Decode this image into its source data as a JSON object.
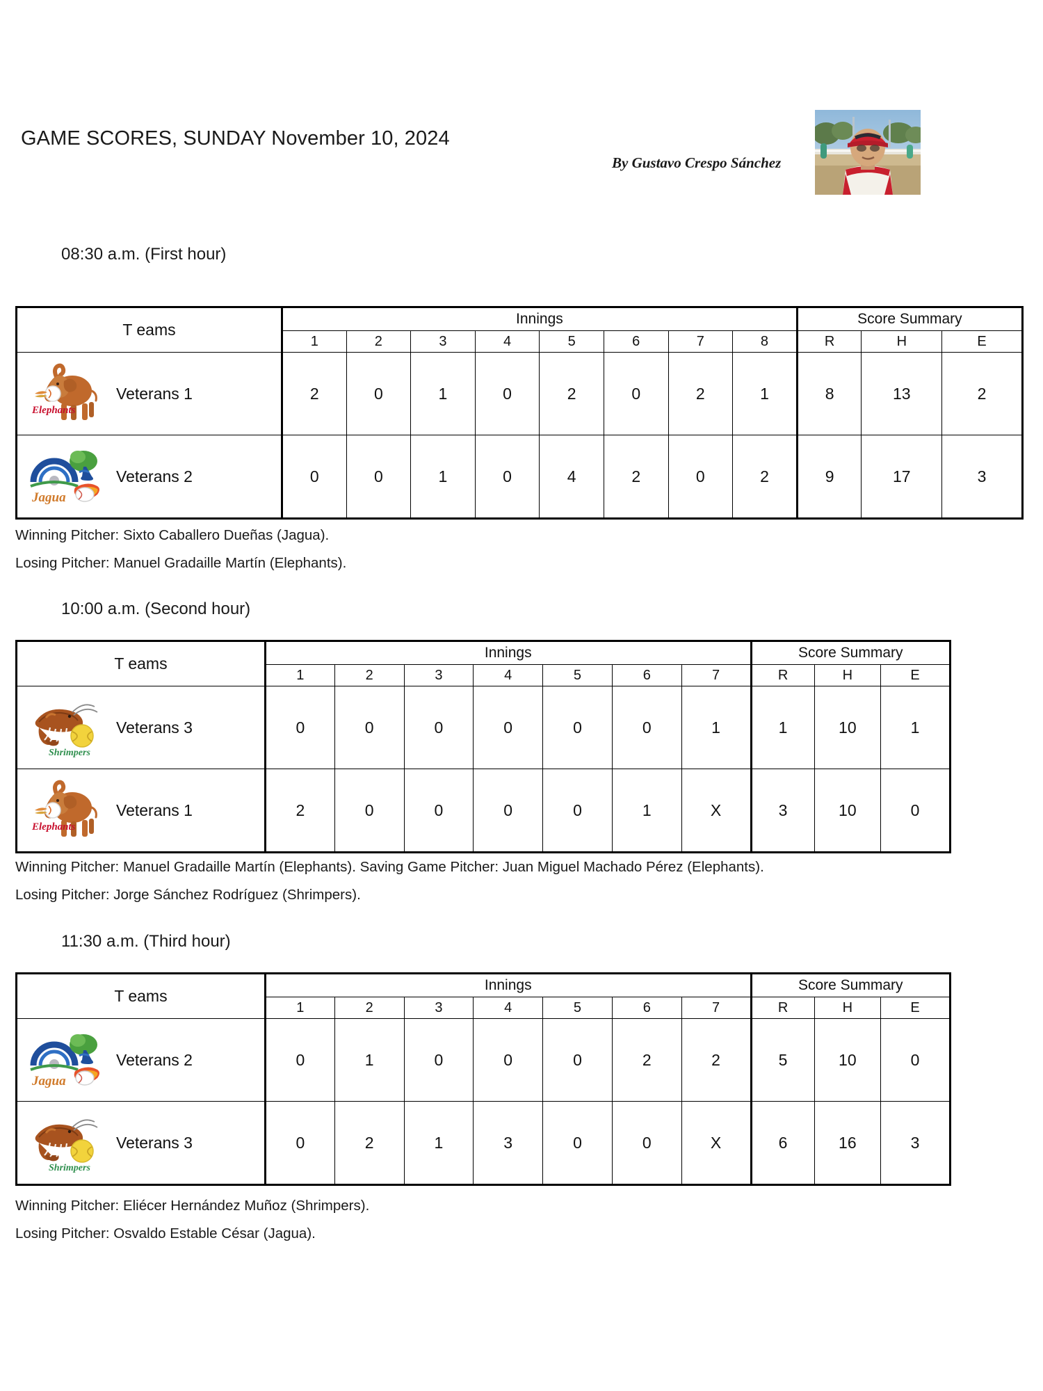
{
  "header": {
    "title": "GAME SCORES, SUNDAY November 10, 2024",
    "byline": "By Gustavo Crespo Sánchez",
    "photo_alt": "author-portrait"
  },
  "labels": {
    "teams": "T eams",
    "innings": "Innings",
    "score_summary": "Score Summary",
    "runs": "R",
    "hits": "H",
    "errors": "E"
  },
  "games": [
    {
      "time_heading": "08:30 a.m. (First hour)",
      "innings_headers": [
        "1",
        "2",
        "3",
        "4",
        "5",
        "6",
        "7",
        "8"
      ],
      "rows": [
        {
          "logo": "elephants-logo",
          "team": "Veterans 1",
          "innings": [
            "2",
            "0",
            "1",
            "0",
            "2",
            "0",
            "2",
            "1"
          ],
          "r": "8",
          "h": "13",
          "e": "2"
        },
        {
          "logo": "jagua-logo",
          "team": "Veterans 2",
          "innings": [
            "0",
            "0",
            "1",
            "0",
            "4",
            "2",
            "0",
            "2"
          ],
          "r": "9",
          "h": "17",
          "e": "3"
        }
      ],
      "notes": [
        "Winning Pitcher: Sixto Caballero Dueñas (Jagua).",
        "Losing Pitcher: Manuel Gradaille Martín (Elephants)."
      ]
    },
    {
      "time_heading": "10:00 a.m. (Second hour)",
      "innings_headers": [
        "1",
        "2",
        "3",
        "4",
        "5",
        "6",
        "7"
      ],
      "rows": [
        {
          "logo": "shrimpers-logo",
          "team": "Veterans 3",
          "innings": [
            "0",
            "0",
            "0",
            "0",
            "0",
            "0",
            "1"
          ],
          "r": "1",
          "h": "10",
          "e": "1"
        },
        {
          "logo": "elephants-logo",
          "team": "Veterans 1",
          "innings": [
            "2",
            "0",
            "0",
            "0",
            "0",
            "1",
            "X"
          ],
          "r": "3",
          "h": "10",
          "e": "0"
        }
      ],
      "notes": [
        "Winning Pitcher: Manuel Gradaille Martín (Elephants). Saving Game Pitcher: Juan Miguel Machado Pérez (Elephants).",
        "Losing Pitcher: Jorge Sánchez Rodríguez (Shrimpers)."
      ]
    },
    {
      "time_heading": "11:30 a.m. (Third hour)",
      "innings_headers": [
        "1",
        "2",
        "3",
        "4",
        "5",
        "6",
        "7"
      ],
      "rows": [
        {
          "logo": "jagua-logo",
          "team": "Veterans 2",
          "innings": [
            "0",
            "1",
            "0",
            "0",
            "0",
            "2",
            "2"
          ],
          "r": "5",
          "h": "10",
          "e": "0"
        },
        {
          "logo": "shrimpers-logo",
          "team": "Veterans 3",
          "innings": [
            "0",
            "2",
            "1",
            "3",
            "0",
            "0",
            "X"
          ],
          "r": "6",
          "h": "16",
          "e": "3"
        }
      ],
      "notes": [
        "Winning Pitcher: Eliécer Hernández Muñoz (Shrimpers).",
        "Losing Pitcher: Osvaldo Estable César (Jagua)."
      ]
    }
  ],
  "colors": {
    "elephant_body": "#c0692c",
    "elephant_text": "#c8102e",
    "jagua_arch": "#1f4e9c",
    "jagua_tree": "#4aa03f",
    "jagua_text": "#d07a2a",
    "shrimp_body": "#a8531f",
    "shrimpers_text": "#2f8f4e",
    "ball_yellow": "#f2d33c",
    "border": "#000000"
  }
}
